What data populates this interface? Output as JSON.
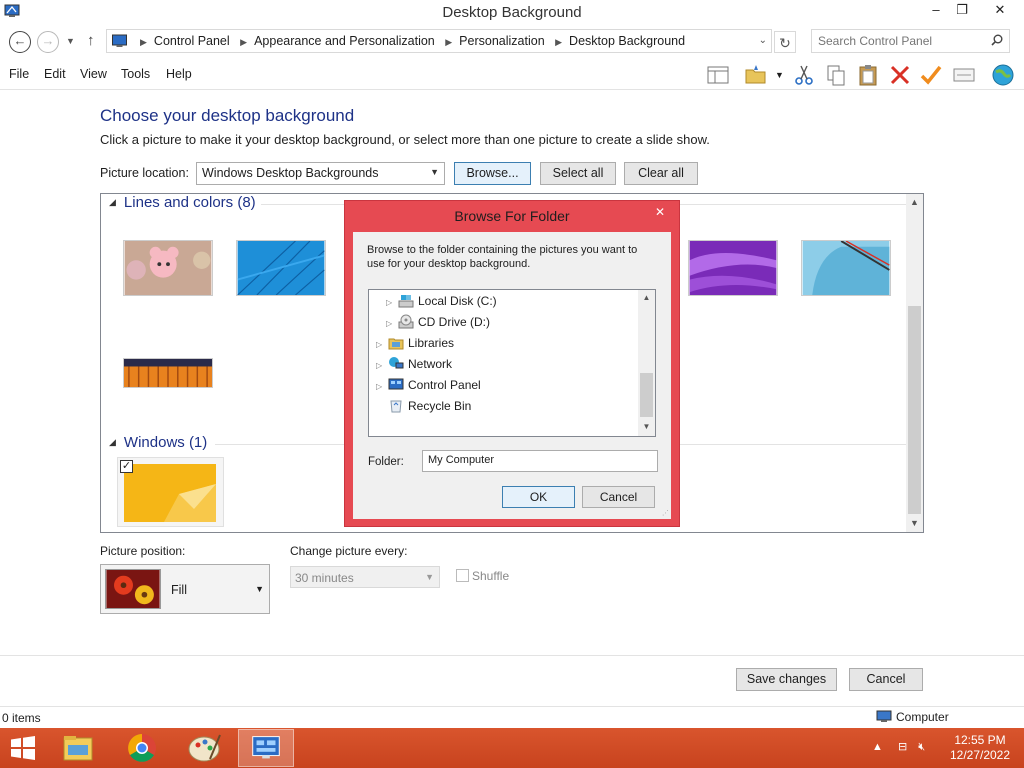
{
  "window": {
    "title": "Desktop Background",
    "min": "–",
    "max": "❐",
    "close": "✕"
  },
  "address": {
    "crumbs": [
      "Control Panel",
      "Appearance and Personalization",
      "Personalization",
      "Desktop Background"
    ],
    "search_placeholder": "Search Control Panel"
  },
  "menu": {
    "file": "File",
    "edit": "Edit",
    "view": "View",
    "tools": "Tools",
    "help": "Help"
  },
  "page": {
    "title": "Choose your desktop background",
    "description": "Click a picture to make it your desktop background, or select more than one picture to create a slide show.",
    "location_label": "Picture location:",
    "location_value": "Windows Desktop Backgrounds",
    "browse": "Browse...",
    "select_all": "Select all",
    "clear_all": "Clear all",
    "groups": [
      {
        "name": "Lines and colors (8)"
      },
      {
        "name": "Windows (1)"
      }
    ],
    "position_label": "Picture position:",
    "position_value": "Fill",
    "change_label": "Change picture every:",
    "change_value": "30 minutes",
    "shuffle": "Shuffle",
    "save": "Save changes",
    "cancel": "Cancel"
  },
  "dialog": {
    "title": "Browse For Folder",
    "close": "✕",
    "message": "Browse to the folder containing the pictures you want to use for your desktop background.",
    "tree": [
      "Local Disk (C:)",
      "CD Drive (D:)",
      "Libraries",
      "Network",
      "Control Panel",
      "Recycle Bin"
    ],
    "folder_label": "Folder:",
    "folder_value": "My Computer",
    "ok": "OK",
    "cancel": "Cancel"
  },
  "status": {
    "items": "0 items",
    "location": "Computer"
  },
  "clock": {
    "time": "12:55 PM",
    "date": "12/27/2022"
  },
  "colors": {
    "taskbar": "#c8431e",
    "dialog_frame": "#e64a52",
    "link_blue": "#1e3287"
  }
}
